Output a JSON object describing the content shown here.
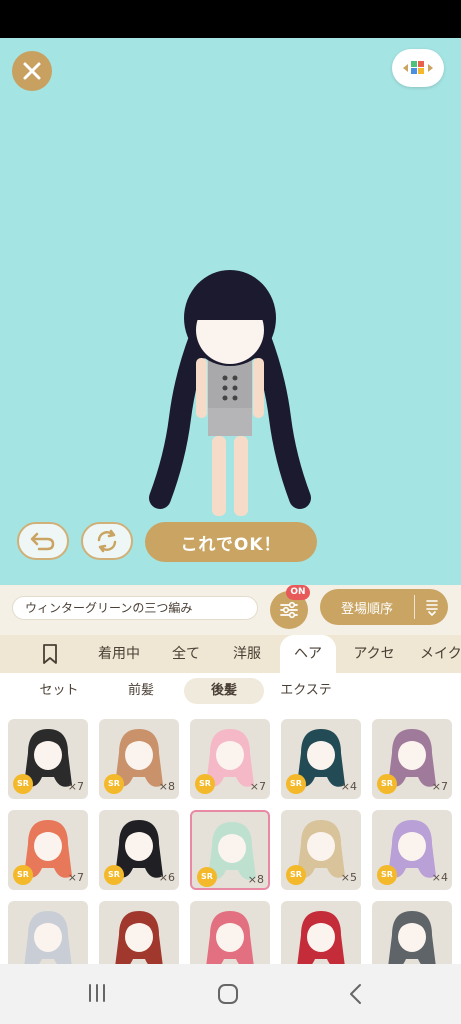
{
  "header": {
    "close_icon": "close-icon",
    "layout_icon": "color-blocks-icon"
  },
  "stage": {
    "undo_icon": "undo-icon",
    "rotate_icon": "rotate-icon",
    "ok_label": "これでOK！"
  },
  "info": {
    "item_name": "ウィンターグリーンの三つ編み",
    "filter_badge": "ON",
    "sort_label": "登場順序"
  },
  "tabs": [
    "着用中",
    "全て",
    "洋服",
    "ヘア",
    "アクセ",
    "メイク"
  ],
  "active_tab": "ヘア",
  "subtabs": [
    "セット",
    "前髪",
    "後髪",
    "エクステ"
  ],
  "active_subtab": "後髪",
  "items": [
    {
      "rarity": "SR",
      "count": "×7",
      "hair": "#2b2b2b"
    },
    {
      "rarity": "SR",
      "count": "×8",
      "hair": "#c9926a"
    },
    {
      "rarity": "SR",
      "count": "×7",
      "hair": "#f5b8c6"
    },
    {
      "rarity": "SR",
      "count": "×4",
      "hair": "#234b55"
    },
    {
      "rarity": "SR",
      "count": "×7",
      "hair": "#a07a9a"
    },
    {
      "rarity": "SR",
      "count": "×7",
      "hair": "#e8785a"
    },
    {
      "rarity": "SR",
      "count": "×6",
      "hair": "#1f1f24"
    },
    {
      "rarity": "SR",
      "count": "×8",
      "hair": "#bde0cf"
    },
    {
      "rarity": "SR",
      "count": "×5",
      "hair": "#d8c39a"
    },
    {
      "rarity": "SR",
      "count": "×4",
      "hair": "#b9a0d6"
    },
    {
      "rarity": "",
      "count": "",
      "hair": "#c9ced6"
    },
    {
      "rarity": "",
      "count": "",
      "hair": "#a0382e"
    },
    {
      "rarity": "",
      "count": "",
      "hair": "#e27080"
    },
    {
      "rarity": "",
      "count": "",
      "hair": "#c42c3a"
    },
    {
      "rarity": "",
      "count": "",
      "hair": "#5e6468"
    }
  ],
  "selected_index": 7,
  "nav": {
    "recent": "recents-icon",
    "home": "home-icon",
    "back": "back-icon"
  },
  "colors": {
    "stage_bg": "#a4e4e3",
    "accent": "#c9a462",
    "badge": "#e85a5a",
    "rarity": "#f3b92a"
  }
}
